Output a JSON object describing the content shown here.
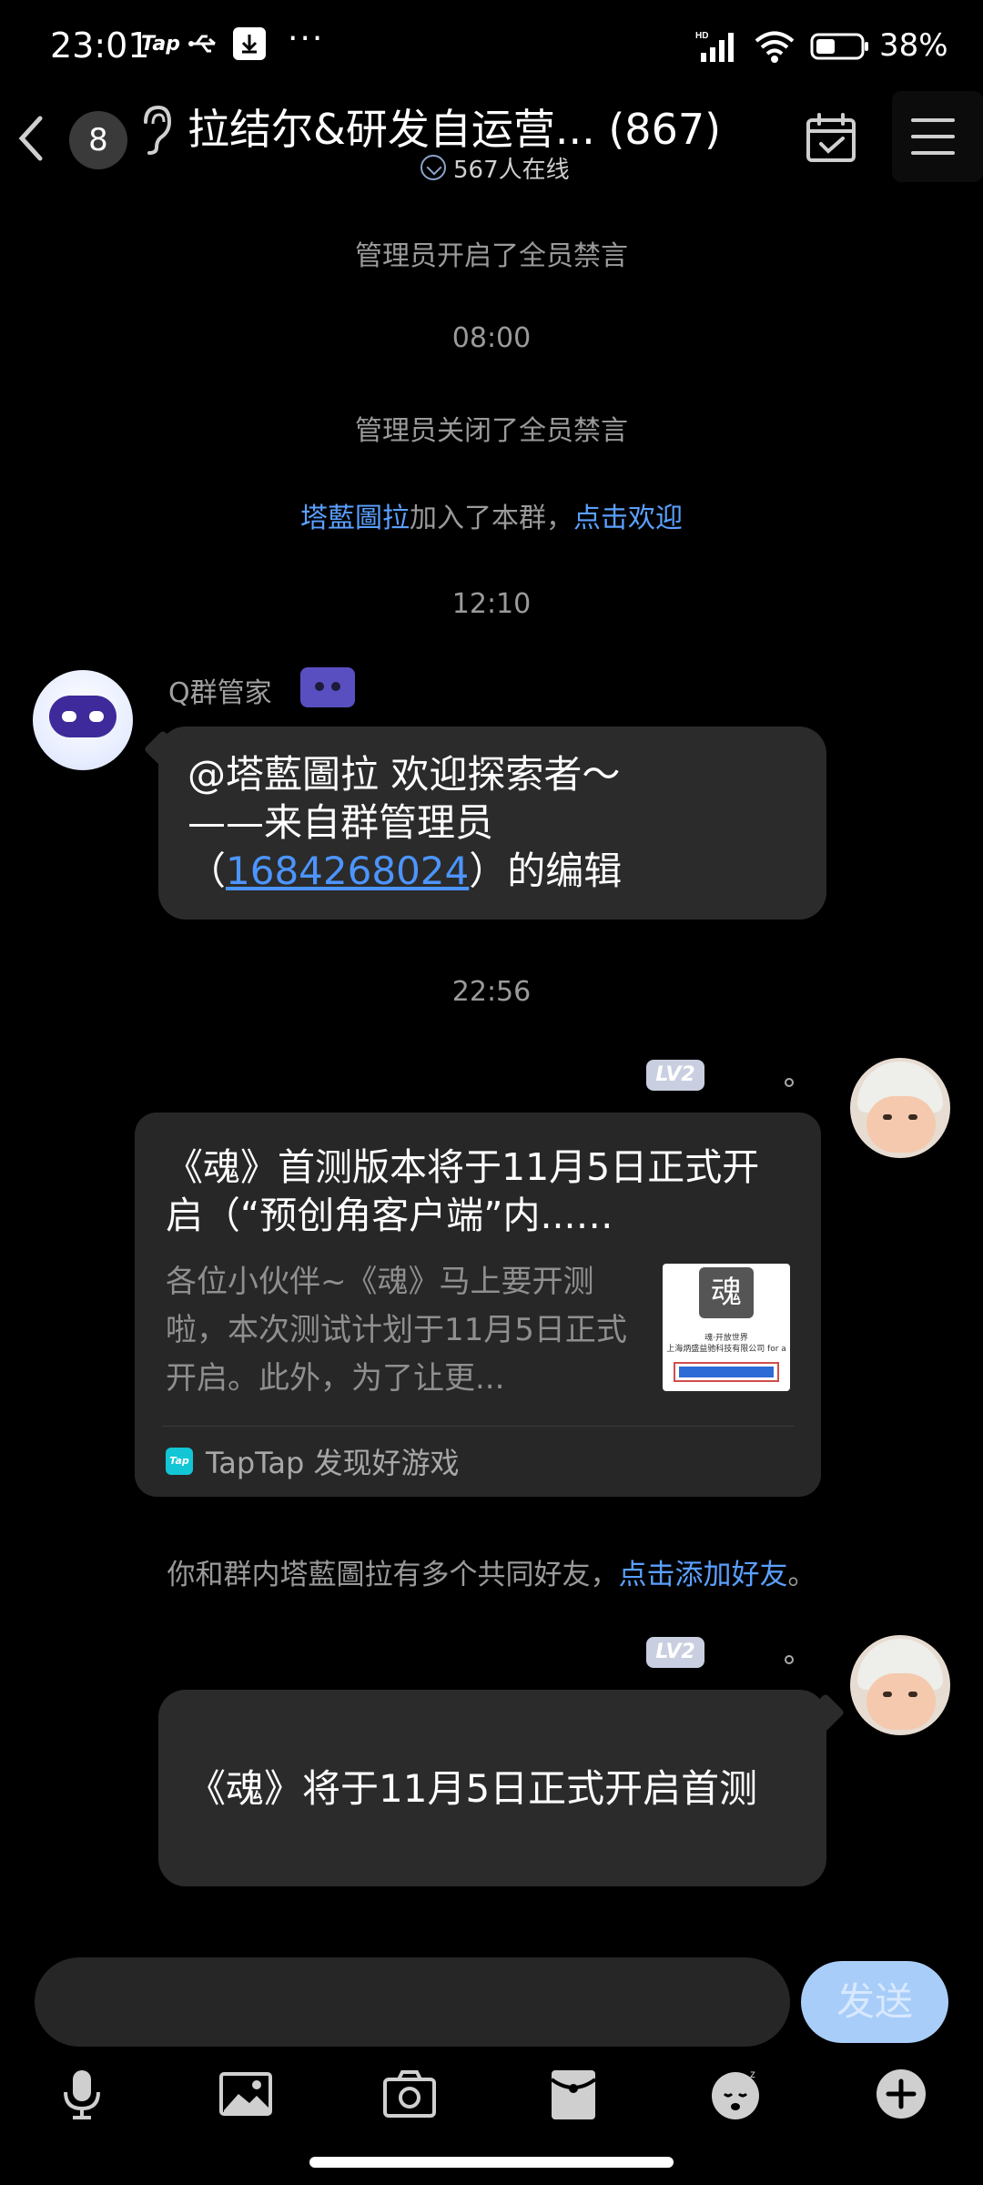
{
  "status_bar": {
    "time": "23:01",
    "tap_label": "Tap",
    "dots": "···",
    "battery_percent": "38%"
  },
  "header": {
    "unread_badge": "8",
    "title": "拉结尔&研发自运营... (867)",
    "online": "567人在线"
  },
  "messages": {
    "sys1": "管理员开启了全员禁言",
    "time1": "08:00",
    "sys2": "管理员关闭了全员禁言",
    "join_name": "塔藍圖拉",
    "join_mid": "加入了本群，",
    "join_link": "点击欢迎",
    "time2": "12:10",
    "bot_name": "Q群管家",
    "bot_line1": "@塔藍圖拉 欢迎探索者～",
    "bot_line2": "——来自群管理员",
    "bot_line3_pre": "（",
    "bot_line3_link": "1684268024",
    "bot_line3_post": "）的编辑",
    "time3": "22:56",
    "lv_badge_1": "LV2",
    "card_title": "《魂》首测版本将于11月5日正式开启（“预创角客户端”内...…",
    "card_desc": "各位小伙伴~《魂》马上要开测啦，本次测试计划于11月5日正式开启。此外，为了让更...",
    "card_thumb_logo": "魂",
    "card_thumb_line1": "魂·开放世界",
    "card_thumb_line2": "上海炳盛益驰科技有限公司 for a",
    "card_source": "TapTap 发现好游戏",
    "taptap_logo": "Tap",
    "friends_text": "你和群内塔藍圖拉有多个共同好友，",
    "friends_link": "点击添加好友",
    "friends_end": "。",
    "lv_badge_2": "LV2",
    "my_message": "《魂》将于11月5日正式开启首测"
  },
  "input": {
    "send_label": "发送"
  },
  "colors": {
    "background": "#000000",
    "bubble": "#2b2b2b",
    "link": "#4c95ff",
    "send_button": "#a8cdf9"
  },
  "icons": [
    "back-icon",
    "ear-icon",
    "calendar-check-icon",
    "menu-icon",
    "microphone-icon",
    "image-icon",
    "camera-icon",
    "red-packet-icon",
    "sticker-icon",
    "plus-icon"
  ]
}
